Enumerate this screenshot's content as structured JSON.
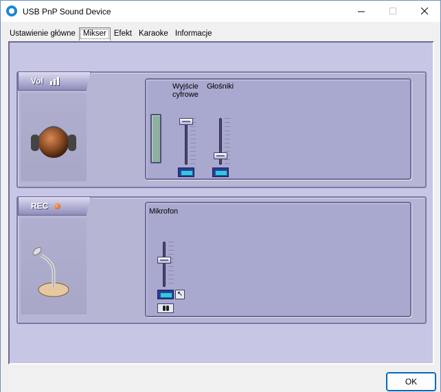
{
  "window": {
    "title": "USB PnP Sound Device",
    "controls": [
      "minimize",
      "maximize",
      "close"
    ]
  },
  "tabs": [
    {
      "label": "Ustawienie główne",
      "active": false
    },
    {
      "label": "Mikser",
      "active": true
    },
    {
      "label": "Efekt",
      "active": false
    },
    {
      "label": "Karaoke",
      "active": false
    },
    {
      "label": "Informacje",
      "active": false
    }
  ],
  "volume_section": {
    "badge": "Vol",
    "icon": "headphones-icon",
    "channels": [
      {
        "label": "Wyjście cyfrowe",
        "level": 0.95,
        "muted": false
      },
      {
        "label": "Głośniki",
        "level": 0.12,
        "muted": false
      }
    ]
  },
  "record_section": {
    "badge": "REC",
    "icon": "microphone-icon",
    "channels": [
      {
        "label": "Mikrofon",
        "level": 0.55,
        "muted": false
      }
    ]
  },
  "footer": {
    "ok_label": "OK"
  },
  "colors": {
    "panel": "#c7c6e4",
    "section": "#b6b5d4",
    "mute_button": "#37c6e6",
    "ok_border": "#0067c0"
  }
}
